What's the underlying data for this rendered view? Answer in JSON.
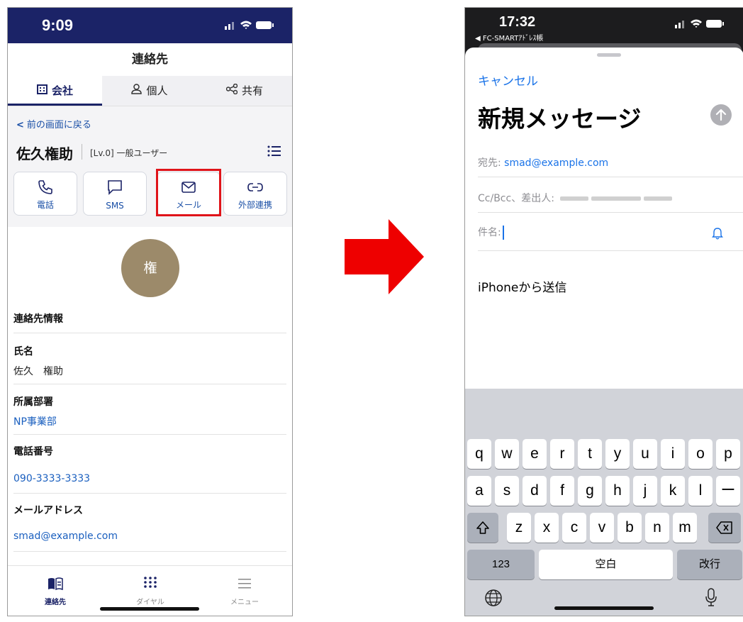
{
  "left_phone": {
    "status_time": "9:09",
    "nav_title": "連絡先",
    "tabs": [
      {
        "label": "会社",
        "icon": "building-icon"
      },
      {
        "label": "個人",
        "icon": "person-icon"
      },
      {
        "label": "共有",
        "icon": "share-icon"
      }
    ],
    "back_link": "前の画面に戻る",
    "user_name": "佐久権助",
    "user_level": "[Lv.0] 一般ユーザー",
    "actions": [
      {
        "label": "電話",
        "icon": "phone-icon"
      },
      {
        "label": "SMS",
        "icon": "sms-icon"
      },
      {
        "label": "メール",
        "icon": "mail-icon"
      },
      {
        "label": "外部連携",
        "icon": "link-icon"
      }
    ],
    "avatar_initial": "権",
    "section_title": "連絡先情報",
    "fields": {
      "name_label": "氏名",
      "name_value": "佐久　権助",
      "dept_label": "所属部署",
      "dept_value": "NP事業部",
      "phone_label": "電話番号",
      "phone_value": "090-3333-3333",
      "email_label": "メールアドレス",
      "email_value": "smad@example.com"
    },
    "bottom_nav": [
      {
        "label": "連絡先",
        "icon": "book-icon"
      },
      {
        "label": "ダイヤル",
        "icon": "dialpad-icon"
      },
      {
        "label": "メニュー",
        "icon": "menu-icon"
      }
    ]
  },
  "right_phone": {
    "status_time": "17:32",
    "back_app": "◀ FC-SMARTｱﾄﾞﾚｽ帳",
    "cancel": "キャンセル",
    "title": "新規メッセージ",
    "to_label": "宛先:",
    "to_value": "smad@example.com",
    "cc_label": "Cc/Bcc、差出人:",
    "subject_label": "件名:",
    "body": "iPhoneから送信",
    "keyboard": {
      "row1": [
        "q",
        "w",
        "e",
        "r",
        "t",
        "y",
        "u",
        "i",
        "o",
        "p"
      ],
      "row2": [
        "a",
        "s",
        "d",
        "f",
        "g",
        "h",
        "j",
        "k",
        "l",
        "ー"
      ],
      "row3": [
        "z",
        "x",
        "c",
        "v",
        "b",
        "n",
        "m"
      ],
      "numbers_key": "123",
      "space_key": "空白",
      "return_key": "改行"
    }
  },
  "colors": {
    "navy": "#1b2367",
    "highlight_red": "#e0141a",
    "arrow_red": "#ee0000",
    "ios_blue": "#1a73e8",
    "avatar_brown": "#9c8a6a"
  }
}
